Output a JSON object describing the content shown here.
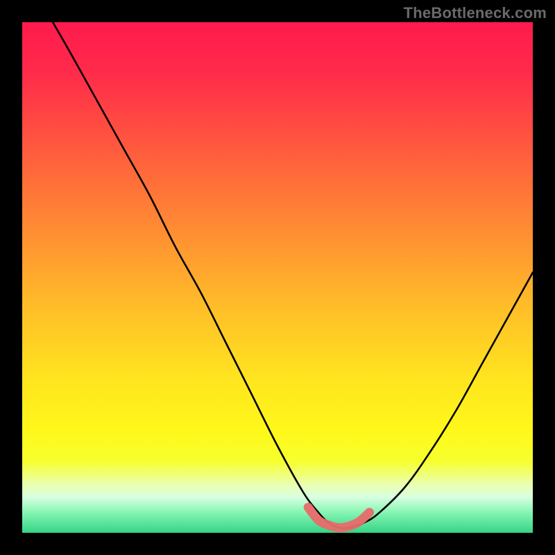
{
  "watermark": {
    "text": "TheBottleneck.com"
  },
  "chart_data": {
    "type": "line",
    "title": "",
    "xlabel": "",
    "ylabel": "",
    "xlim": [
      0,
      100
    ],
    "ylim": [
      0,
      100
    ],
    "grid": false,
    "legend": false,
    "series": [
      {
        "name": "curve",
        "x": [
          6,
          10,
          15,
          20,
          25,
          30,
          35,
          40,
          45,
          50,
          55,
          58,
          60,
          62,
          64,
          67,
          70,
          75,
          80,
          85,
          90,
          95,
          100
        ],
        "y": [
          100,
          93,
          84,
          75,
          66,
          56,
          47,
          37,
          27,
          17,
          8,
          4,
          2,
          1,
          1,
          2,
          4,
          9,
          16,
          24,
          33,
          42,
          51
        ]
      },
      {
        "name": "optimal-zone",
        "x": [
          56,
          58,
          60,
          62,
          64,
          66,
          68
        ],
        "y": [
          5,
          2.5,
          1.5,
          1,
          1.3,
          2.2,
          4
        ]
      }
    ],
    "gradient_stops": [
      {
        "offset": 0.0,
        "color": "#ff1a4d"
      },
      {
        "offset": 0.1,
        "color": "#ff2b4a"
      },
      {
        "offset": 0.25,
        "color": "#ff5b3e"
      },
      {
        "offset": 0.4,
        "color": "#ff8a33"
      },
      {
        "offset": 0.55,
        "color": "#ffbb29"
      },
      {
        "offset": 0.7,
        "color": "#ffe51f"
      },
      {
        "offset": 0.8,
        "color": "#fff81a"
      },
      {
        "offset": 0.86,
        "color": "#f6ff2e"
      },
      {
        "offset": 0.905,
        "color": "#eaffb0"
      },
      {
        "offset": 0.93,
        "color": "#d8ffe0"
      },
      {
        "offset": 0.96,
        "color": "#86f5b3"
      },
      {
        "offset": 1.0,
        "color": "#35d487"
      }
    ]
  }
}
